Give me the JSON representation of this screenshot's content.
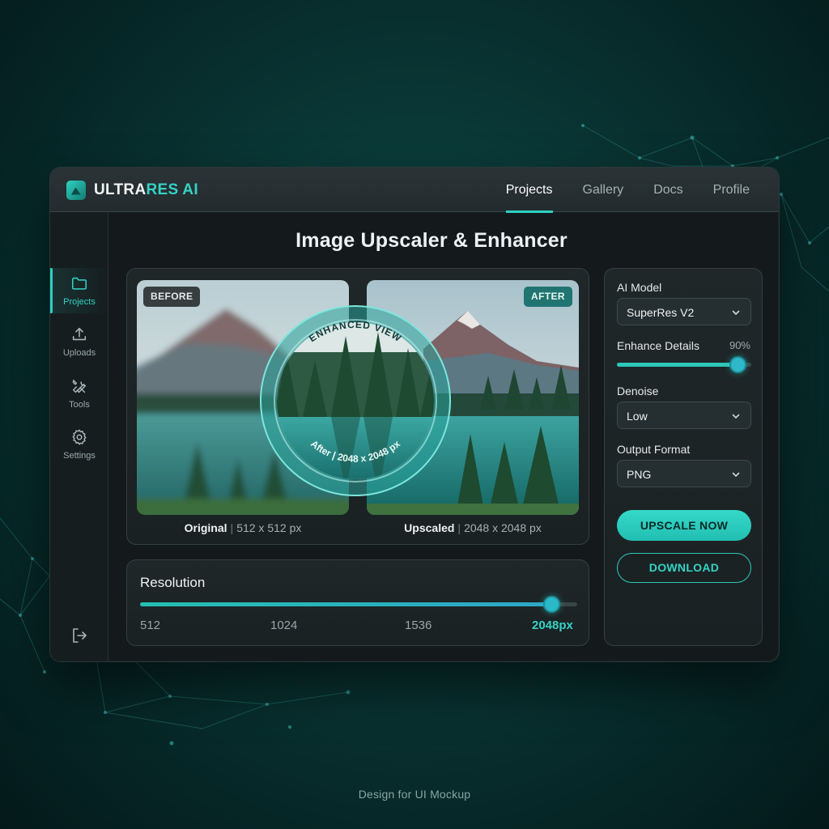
{
  "app": {
    "brand_main": "ULTRA",
    "brand_accent": "RES AI",
    "accent_color": "#2ed0c2"
  },
  "nav": {
    "tabs": [
      {
        "label": "Projects",
        "active": true
      },
      {
        "label": "Gallery",
        "active": false
      },
      {
        "label": "Docs",
        "active": false
      },
      {
        "label": "Profile",
        "active": false
      }
    ]
  },
  "sidebar": {
    "items": [
      {
        "label": "Projects",
        "icon": "folder-icon",
        "active": true
      },
      {
        "label": "Uploads",
        "icon": "upload-icon",
        "active": false
      },
      {
        "label": "Tools",
        "icon": "tools-icon",
        "active": false
      },
      {
        "label": "Settings",
        "icon": "gear-icon",
        "active": false
      }
    ],
    "logout_icon": "logout-icon"
  },
  "main": {
    "title": "Image Upscaler & Enhancer"
  },
  "compare": {
    "before_tag": "BEFORE",
    "after_tag": "AFTER",
    "original_label": "Original",
    "original_size": "512 x 512 px",
    "upscaled_label": "Upscaled",
    "upscaled_size": "2048 x 2048 px",
    "loupe_top_text": "ENHANCED VIEW",
    "loupe_bottom_text": "After | 2048 x 2048 px"
  },
  "resolution": {
    "label": "Resolution",
    "ticks": [
      "512",
      "1024",
      "1536",
      "2048px"
    ],
    "value_fraction": 0.94
  },
  "settings": {
    "ai_model_label": "AI Model",
    "ai_model_value": "SuperRes V2",
    "enhance_label": "Enhance Details",
    "enhance_value_text": "90%",
    "enhance_fraction": 0.9,
    "denoise_label": "Denoise",
    "denoise_value": "Low",
    "output_label": "Output Format",
    "output_value": "PNG",
    "upscale_button": "UPSCALE NOW",
    "download_button": "DOWNLOAD"
  },
  "footer": {
    "credit": "Design for UI Mockup"
  }
}
